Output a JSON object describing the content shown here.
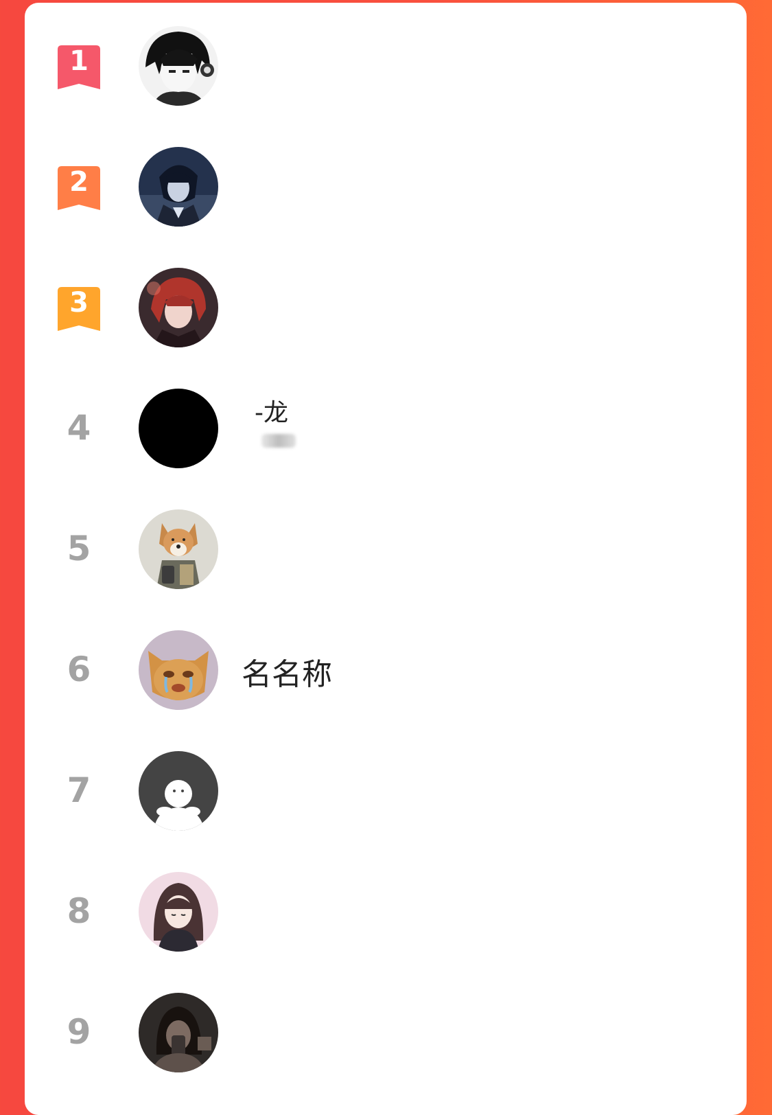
{
  "leaderboard": {
    "rows": [
      {
        "rank": "1",
        "style": "medal",
        "medal_color": "#f5586a",
        "avatar": "anime-boy-headphones-avatar",
        "name": ""
      },
      {
        "rank": "2",
        "style": "medal",
        "medal_color": "#ff7e47",
        "avatar": "anime-boy-dark-avatar",
        "name": ""
      },
      {
        "rank": "3",
        "style": "medal",
        "medal_color": "#ffa52c",
        "avatar": "anime-redhair-avatar",
        "name": ""
      },
      {
        "rank": "4",
        "style": "plain",
        "avatar": "black-circle-avatar",
        "name": "-龙"
      },
      {
        "rank": "5",
        "style": "plain",
        "avatar": "shiba-dog-avatar",
        "name": ""
      },
      {
        "rank": "6",
        "style": "plain",
        "avatar": "crying-cat-avatar",
        "name": "名名称"
      },
      {
        "rank": "7",
        "style": "plain",
        "avatar": "default-user-avatar",
        "name": ""
      },
      {
        "rank": "8",
        "style": "plain",
        "avatar": "anime-girl-avatar",
        "name": ""
      },
      {
        "rank": "9",
        "style": "plain",
        "avatar": "dark-photo-avatar",
        "name": ""
      }
    ]
  }
}
